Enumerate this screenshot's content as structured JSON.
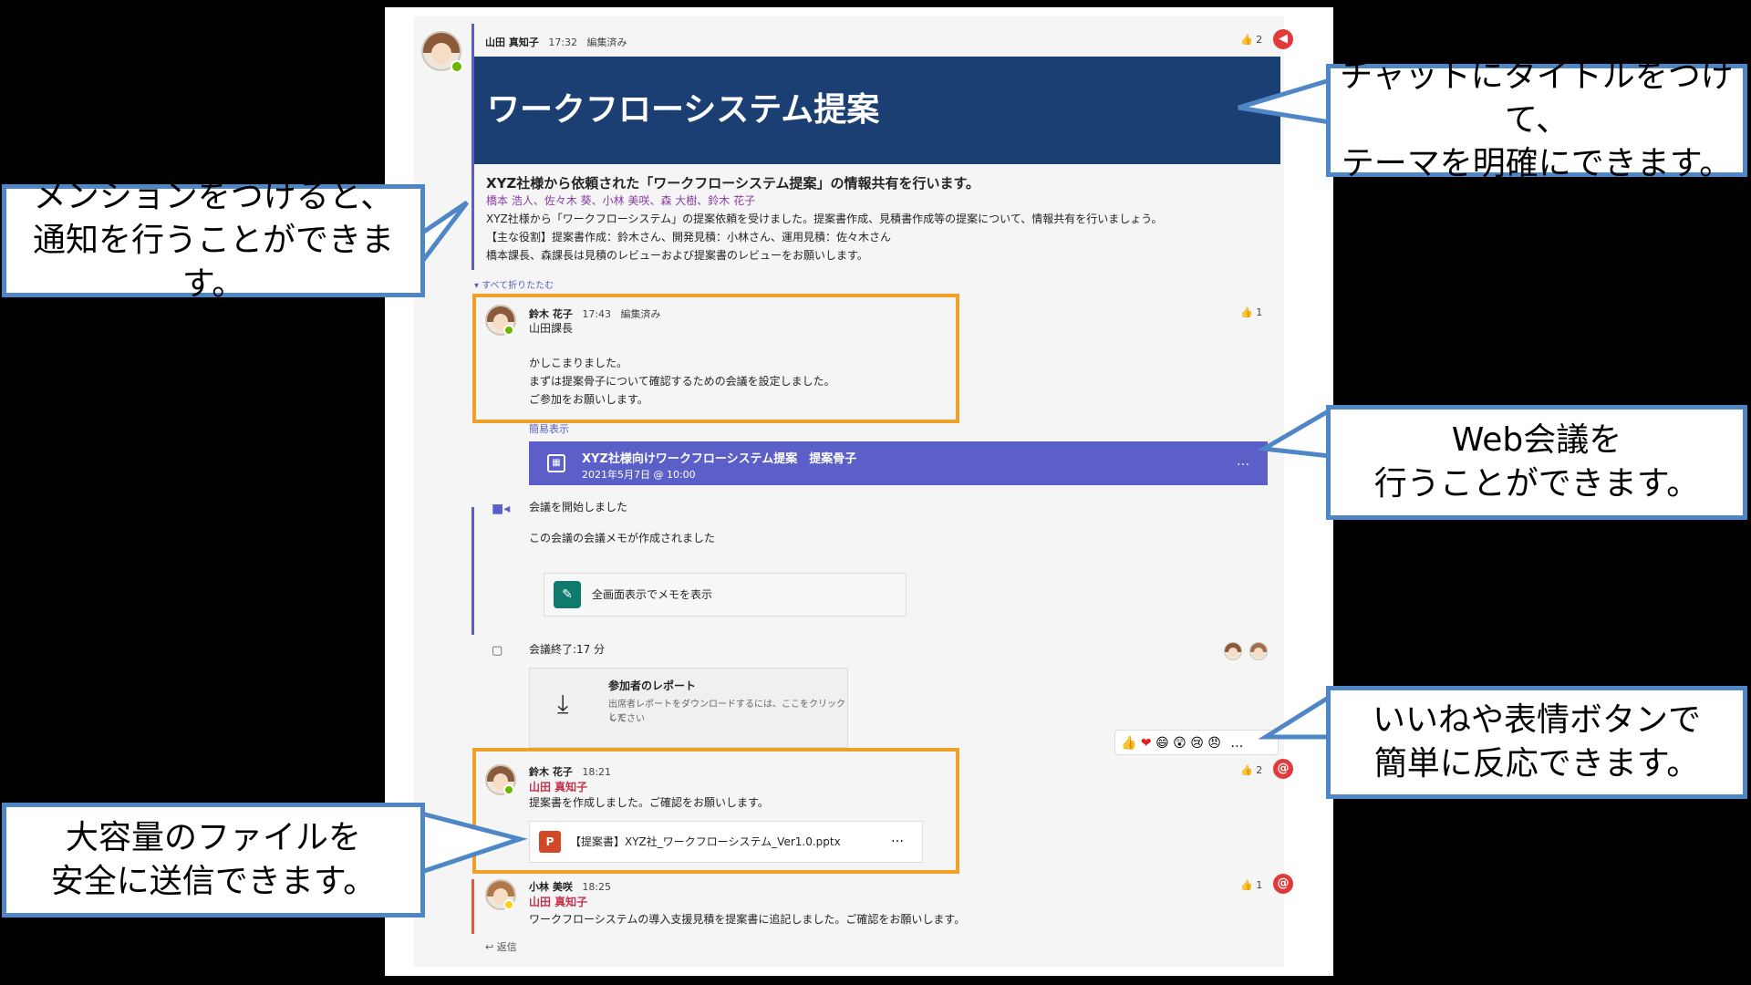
{
  "post": {
    "author": "山田 真知子",
    "time": "17:32",
    "edited": "編集済み",
    "likes": "2",
    "banner_title": "ワークフローシステム提案",
    "heading": "XYZ社様から依頼された「ワークフローシステム提案」の情報共有を行います。",
    "mentions": "橋本 浩人、佐々木 葵、小林 美咲、森 大樹、鈴木 花子",
    "body_1": "XYZ社様から「ワークフローシステム」の提案依頼を受けました。提案書作成、見積書作成等の提案について、情報共有を行いましょう。",
    "body_2": "【主な役割】提案書作成：鈴木さん、開発見積：小林さん、運用見積：佐々木さん",
    "body_3": "橋本課長、森課長は見積のレビューおよび提案書のレビューをお願いします。",
    "collapse_all": "すべて折りたたむ"
  },
  "reply1": {
    "author": "鈴木 花子",
    "time": "17:43",
    "edited": "編集済み",
    "likes": "1",
    "line1": "山田課長",
    "line2": "かしこまりました。",
    "line3": "まずは提案骨子について確認するための会議を設定しました。",
    "line4": "ご参加をお願いします。",
    "simple_view": "簡易表示"
  },
  "meeting": {
    "title": "XYZ社様向けワークフローシステム提案　提案骨子",
    "datetime": "2021年5月7日 @ 10:00",
    "more": "…",
    "started": "会議を開始しました",
    "notes_created": "この会議の会議メモが作成されました",
    "notes_button": "全画面表示でメモを表示",
    "ended": "会議終了:17 分",
    "report_title": "参加者のレポート",
    "report_desc_1": "出席者レポートをダウンロードするには、ここをクリックして",
    "report_desc_2": "ください"
  },
  "reply2": {
    "author": "鈴木 花子",
    "time": "18:21",
    "likes": "2",
    "mention": "山田 真知子",
    "text": "提案書を作成しました。ご確認をお願いします。",
    "file": "【提案書】XYZ社_ワークフローシステム_Ver1.0.pptx",
    "file_more": "…"
  },
  "reply3": {
    "author": "小林 美咲",
    "time": "18:25",
    "likes": "1",
    "mention": "山田 真知子",
    "text": "ワークフローシステムの導入支援見積を提案書に追記しました。ご確認をお願いします。"
  },
  "reply_button": "返信",
  "reactions": [
    "👍",
    "❤",
    "😄",
    "😲",
    "😢",
    "😠"
  ],
  "reactions_more": "…",
  "callouts": {
    "title_1": "チャットにタイトルをつけて、",
    "title_2": "テーマを明確にできます。",
    "mention_1": "メンションをつけると、",
    "mention_2": "通知を行うことができます。",
    "web_1": "Web会議を",
    "web_2": "行うことができます。",
    "react_1": "いいねや表情ボタンで",
    "react_2": "簡単に反応できます。",
    "file_1": "大容量のファイルを",
    "file_2": "安全に送信できます。"
  },
  "colors": {
    "banner": "#1b3f73",
    "meeting": "#5b5fc7",
    "highlight": "#f0a028",
    "callout_border": "#4f87c6",
    "mention_red": "#c4314b"
  }
}
